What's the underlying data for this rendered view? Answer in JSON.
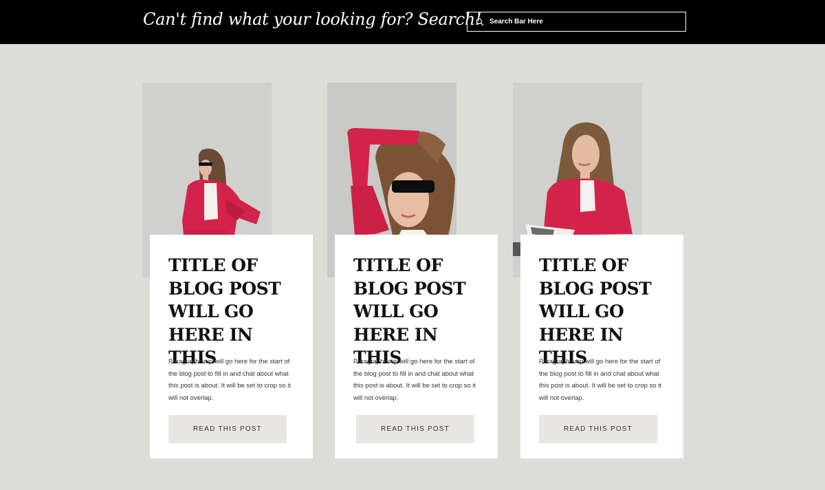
{
  "header": {
    "tagline": "Can't find what your looking for? Search!",
    "search_placeholder": "Search Bar Here"
  },
  "colors": {
    "header_bg": "#000000",
    "page_bg": "#dcddd7",
    "card_bg": "#ffffff",
    "button_bg": "#e8e6e2",
    "accent_red": "#d4234a"
  },
  "posts": [
    {
      "title": "TITLE OF BLOG POST WILL GO HERE IN THIS",
      "snippet": "Paragraph snip will go here for the start of the blog post to fill in and chat about what this post is about.  It will be set to crop so it will not overlap.",
      "button_label": "READ THIS POST",
      "image": "woman-red-blazer-sunglasses-standing"
    },
    {
      "title": "TITLE OF BLOG POST WILL GO HERE IN THIS",
      "snippet": "Paragraph snip will go here for the start of the blog post to fill in and chat about what this post is about.  It will be set to crop so it will not overlap.",
      "button_label": "READ THIS POST",
      "image": "woman-red-blazer-sunglasses-arm-raised"
    },
    {
      "title": "TITLE OF BLOG POST WILL GO HERE IN THIS",
      "snippet": "Paragraph snip will go here for the start of the blog post to fill in and chat about what this post is about.  It will be set to crop so it will not overlap.",
      "button_label": "READ THIS POST",
      "image": "woman-red-blazer-reading-magazine"
    }
  ]
}
